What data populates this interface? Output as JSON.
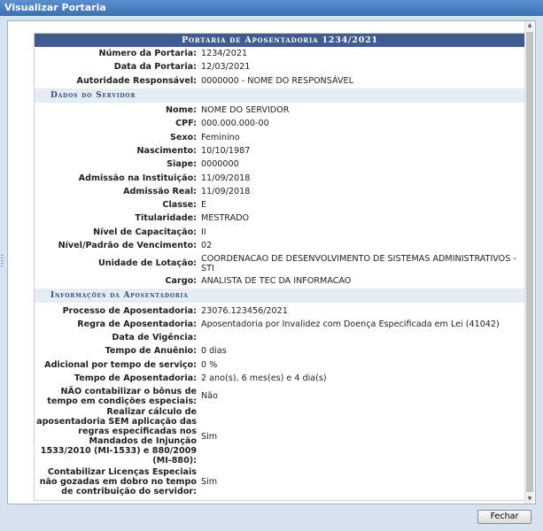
{
  "window": {
    "title": "Visualizar Portaria"
  },
  "panel": {
    "title": "Portaria de Aposentadoria 1234/2021"
  },
  "portaria": {
    "rows": [
      {
        "label": "Número da Portaria:",
        "value": "1234/2021"
      },
      {
        "label": "Data da Portaria:",
        "value": "12/03/2021"
      },
      {
        "label": "Autoridade Responsável:",
        "value": "0000000 - NOME DO RESPONSÁVEL"
      }
    ]
  },
  "servidor": {
    "title": "Dados do Servidor",
    "rows": [
      {
        "label": "Nome:",
        "value": "NOME DO SERVIDOR"
      },
      {
        "label": "CPF:",
        "value": "000.000.000-00"
      },
      {
        "label": "Sexo:",
        "value": "Feminino"
      },
      {
        "label": "Nascimento:",
        "value": "10/10/1987"
      },
      {
        "label": "Siape:",
        "value": "0000000"
      },
      {
        "label": "Admissão na Instituição:",
        "value": "11/09/2018"
      },
      {
        "label": "Admissão Real:",
        "value": "11/09/2018"
      },
      {
        "label": "Classe:",
        "value": "E"
      },
      {
        "label": "Titularidade:",
        "value": "MESTRADO"
      },
      {
        "label": "Nível de Capacitação:",
        "value": "II"
      },
      {
        "label": "Nível/Padrão de Vencimento:",
        "value": "02"
      },
      {
        "label": "Unidade de Lotação:",
        "value": "COORDENACAO DE DESENVOLVIMENTO DE SISTEMAS ADMINISTRATIVOS - STI"
      },
      {
        "label": "Cargo:",
        "value": "ANALISTA DE TEC DA INFORMACAO"
      }
    ]
  },
  "aposentadoria": {
    "title": "Informações da Aposentadoria",
    "rows": [
      {
        "label": "Processo de Aposentadoria:",
        "value": "23076.123456/2021"
      },
      {
        "label": "Regra de Aposentadoria:",
        "value": "Aposentadoria por Invalidez com Doença Especificada em Lei (41042)"
      },
      {
        "label": "Data de Vigência:",
        "value": ""
      },
      {
        "label": "Tempo de Anuênio:",
        "value": "0 dias"
      },
      {
        "label": "Adicional por tempo de serviço:",
        "value": "0 %"
      },
      {
        "label": "Tempo de Aposentadoria:",
        "value": "2 ano(s), 6 mes(es) e 4 dia(s)"
      },
      {
        "label": "NÃO contabilizar o bônus de tempo em condições especiais:",
        "value": "Não"
      },
      {
        "label": "Realizar cálculo de aposentadoria SEM aplicação das regras especificadas nos Mandados de Injunção 1533/2010 (MI-1533) e 880/2009 (MI-880):",
        "value": "Sim"
      },
      {
        "label": "Contabilizar Licenças Especiais não gozadas em dobro no tempo de contribuição do servidor:",
        "value": "Sim"
      }
    ]
  },
  "footer": {
    "close_label": "Fechar"
  }
}
